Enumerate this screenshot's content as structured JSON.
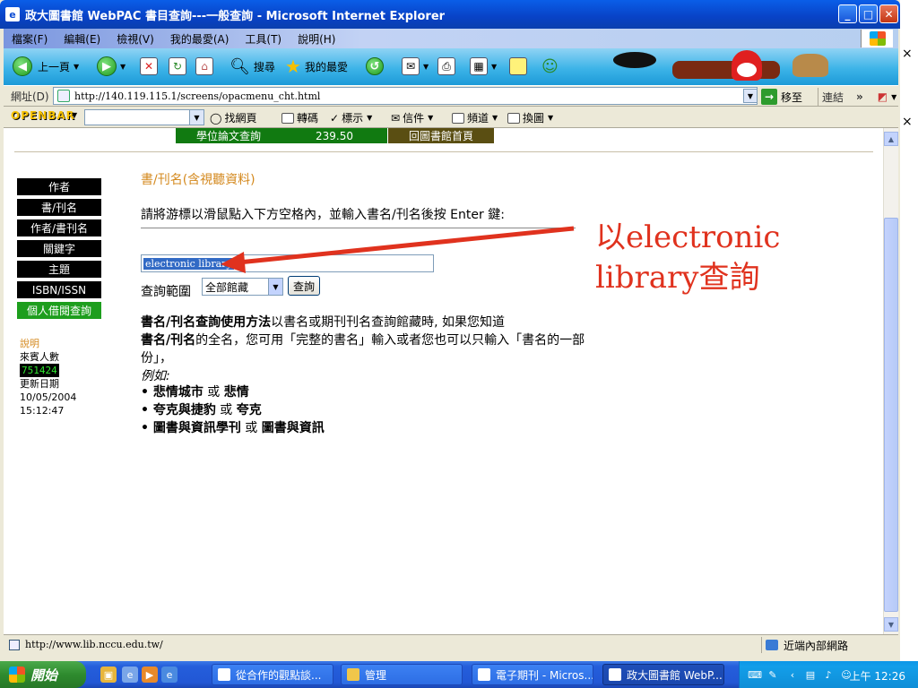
{
  "window": {
    "title": "政大圖書館 WebPAC 書目查詢---一般查詢 - Microsoft Internet Explorer",
    "minimize": "_",
    "maximize": "□",
    "close": "✕"
  },
  "side_close_marks": [
    "×",
    "×"
  ],
  "menu": [
    "檔案(F)",
    "編輯(E)",
    "檢視(V)",
    "我的最愛(A)",
    "工具(T)",
    "說明(H)"
  ],
  "toolbar": {
    "back": "上一頁",
    "search": "搜尋",
    "favorites": "我的最愛"
  },
  "address": {
    "label": "網址(D)",
    "url": "http://140.119.115.1/screens/opacmenu_cht.html",
    "go": "移至",
    "links": "連結"
  },
  "openbar": {
    "logo": "OPENBAR",
    "items": [
      "找網頁",
      "轉碼",
      "標示",
      "信件",
      "頻道",
      "換圖"
    ]
  },
  "page": {
    "top_nav": [
      "學位論文查詢",
      "239.50",
      "回圖書館首頁"
    ],
    "side_nav": [
      "作者",
      "書/刊名",
      "作者/書刊名",
      "關鍵字",
      "主題",
      "ISBN/ISSN",
      "個人借閱查詢"
    ],
    "stats": {
      "help": "說明",
      "visitors_label": "來賓人數",
      "visitors_count": "751424",
      "updated_label": "更新日期",
      "updated_date": "10/05/2004",
      "updated_time": "15:12:47"
    },
    "section_title": "書/刊名(含視聽資料)",
    "instruction": "請將游標以滑鼠點入下方空格內，並輸入書名/刊名後按 Enter 鍵:",
    "search_value": "electronic library",
    "scope_label": "查詢範圍",
    "scope_value": "全部館藏",
    "query_button": "查詢",
    "usage_bold1": "書名/刊名查詢使用方法",
    "usage_text1": "以書名或期刊刊名查詢館藏時, 如果您知道",
    "usage_bold2": "書名/刊名",
    "usage_text2": "的全名，您可用「完整的書名」輸入或者您也可以只輸入「書名的一部份」，",
    "example_label": "例如:",
    "examples": [
      {
        "full": "悲情城市",
        "or": "或",
        "part": "悲情"
      },
      {
        "full": "夸克與捷豹",
        "or": "或",
        "part": "夸克"
      },
      {
        "full": "圖書與資訊學刊",
        "or": "或",
        "part": "圖書與資訊"
      }
    ],
    "annotation_line1": "以electronic",
    "annotation_line2": "library查詢"
  },
  "status": {
    "url": "http://www.lib.nccu.edu.tw/",
    "zone": "近端內部網路"
  },
  "taskbar": {
    "start": "開始",
    "tasks": [
      "從合作的觀點談...",
      "管理",
      "電子期刊 - Micros...",
      "政大圖書館 WebP..."
    ],
    "clock": "上午 12:26"
  },
  "colors": {
    "accent_orange": "#d4891e",
    "annotation_red": "#e0321e",
    "nav_green": "#1d9e1d"
  }
}
